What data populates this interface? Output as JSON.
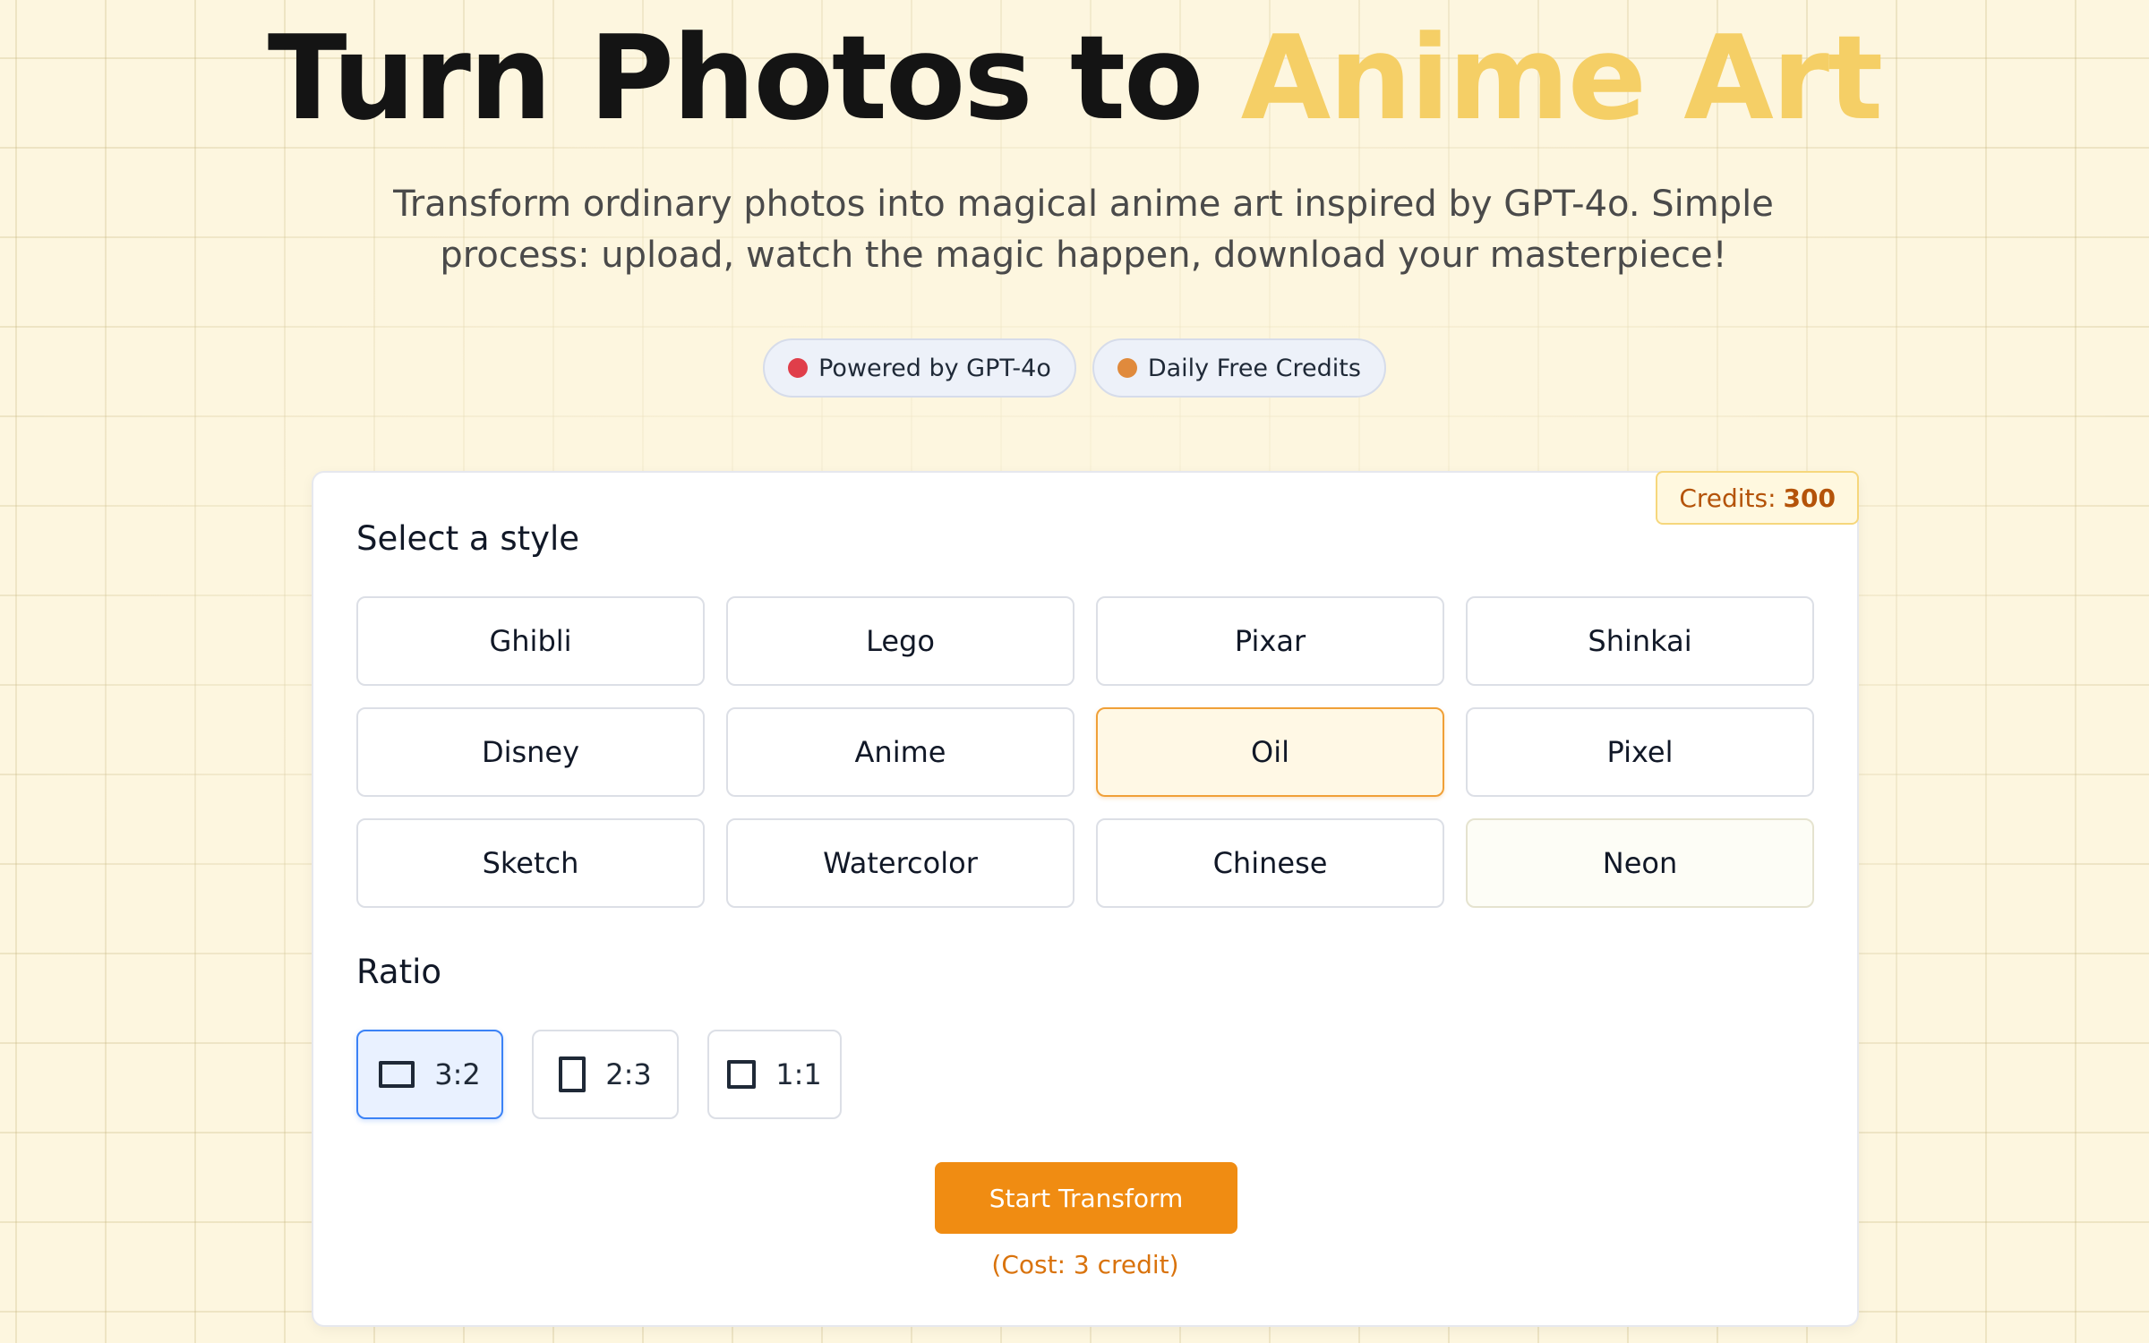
{
  "hero": {
    "title_main": "Turn Photos to ",
    "title_accent": "Anime Art",
    "subtitle": "Transform ordinary photos into magical anime art inspired by GPT-4o. Simple process: upload, watch the magic happen, download your masterpiece!"
  },
  "badges": [
    {
      "label": "Powered by GPT-4o",
      "dot_color": "#e03e4a"
    },
    {
      "label": "Daily Free Credits",
      "dot_color": "#e08a3c"
    }
  ],
  "credits": {
    "label": "Credits:",
    "value": "300"
  },
  "style_section": {
    "title": "Select a style",
    "selected": "Oil",
    "styles": [
      "Ghibli",
      "Lego",
      "Pixar",
      "Shinkai",
      "Disney",
      "Anime",
      "Oil",
      "Pixel",
      "Sketch",
      "Watercolor",
      "Chinese",
      "Neon"
    ]
  },
  "ratio_section": {
    "title": "Ratio",
    "selected": "3:2",
    "options": [
      {
        "label": "3:2",
        "icon": "landscape-rect-icon"
      },
      {
        "label": "2:3",
        "icon": "portrait-rect-icon"
      },
      {
        "label": "1:1",
        "icon": "square-icon"
      }
    ]
  },
  "action": {
    "button_label": "Start Transform",
    "cost_text": "(Cost: 3 credit)"
  },
  "colors": {
    "accent_yellow": "#f5cf66",
    "primary_orange": "#f08c12",
    "selected_blue": "#3b82f6"
  }
}
